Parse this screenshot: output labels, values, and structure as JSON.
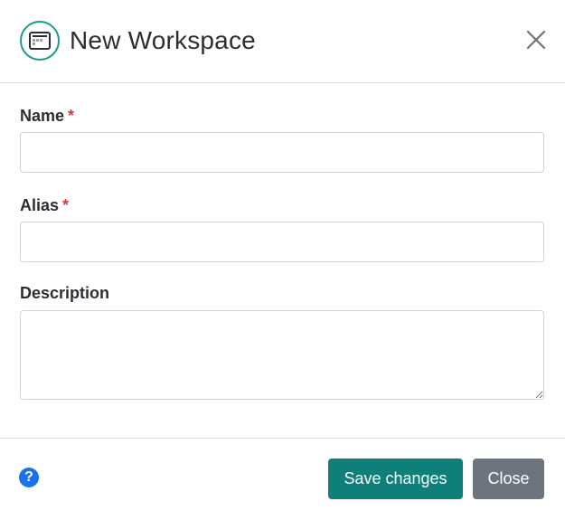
{
  "dialog": {
    "title": "New Workspace",
    "header_icon": "window-icon",
    "close_icon": "close-icon"
  },
  "form": {
    "name": {
      "label": "Name",
      "required_mark": "*",
      "value": "",
      "placeholder": ""
    },
    "alias": {
      "label": "Alias",
      "required_mark": "*",
      "value": "",
      "placeholder": ""
    },
    "description": {
      "label": "Description",
      "value": "",
      "placeholder": ""
    }
  },
  "footer": {
    "help_icon": "question-circle-icon",
    "help_glyph": "?",
    "save_label": "Save changes",
    "close_label": "Close"
  },
  "colors": {
    "accent": "#0f7f7a",
    "secondary": "#6c757d",
    "required": "#dc3545",
    "help": "#1a73e8"
  }
}
